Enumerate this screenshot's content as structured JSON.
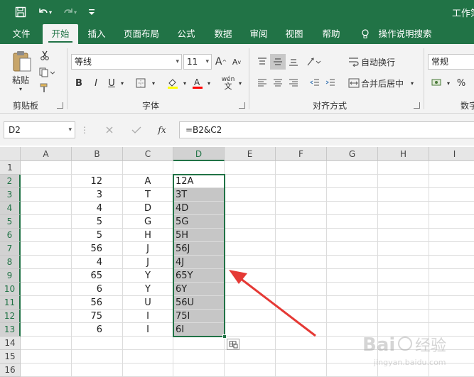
{
  "app": {
    "title": "工作簿"
  },
  "qat": {
    "save_icon": "save-icon",
    "undo_icon": "undo-icon",
    "redo_icon": "redo-icon",
    "customize_icon": "customize-icon"
  },
  "tabs": [
    "文件",
    "开始",
    "插入",
    "页面布局",
    "公式",
    "数据",
    "审阅",
    "视图",
    "帮助"
  ],
  "active_tab": "开始",
  "tell_me": "操作说明搜索",
  "ribbon": {
    "clipboard": {
      "paste_label": "粘贴",
      "group_label": "剪贴板"
    },
    "font": {
      "font_name": "等线",
      "font_size": "11",
      "bold": "B",
      "italic": "I",
      "underline": "U",
      "increase": "A",
      "decrease": "A",
      "group_label": "字体",
      "phonetic": "wén"
    },
    "alignment": {
      "wrap_text": "自动换行",
      "merge_center": "合并后居中",
      "group_label": "对齐方式"
    },
    "number": {
      "format": "常规",
      "percent": "%",
      "group_label": "数字"
    }
  },
  "formula_bar": {
    "name_box": "D2",
    "fx": "fx",
    "formula": "=B2&C2"
  },
  "grid": {
    "columns": [
      "A",
      "B",
      "C",
      "D",
      "E",
      "F",
      "G",
      "H",
      "I"
    ],
    "selected_column": "D",
    "rows": [
      {
        "n": "1",
        "b": "",
        "c": "",
        "d": ""
      },
      {
        "n": "2",
        "b": "12",
        "c": "A",
        "d": "12A"
      },
      {
        "n": "3",
        "b": "3",
        "c": "T",
        "d": "3T"
      },
      {
        "n": "4",
        "b": "4",
        "c": "D",
        "d": "4D"
      },
      {
        "n": "5",
        "b": "5",
        "c": "G",
        "d": "5G"
      },
      {
        "n": "6",
        "b": "5",
        "c": "H",
        "d": "5H"
      },
      {
        "n": "7",
        "b": "56",
        "c": "J",
        "d": "56J"
      },
      {
        "n": "8",
        "b": "4",
        "c": "J",
        "d": "4J"
      },
      {
        "n": "9",
        "b": "65",
        "c": "Y",
        "d": "65Y"
      },
      {
        "n": "10",
        "b": "6",
        "c": "Y",
        "d": "6Y"
      },
      {
        "n": "11",
        "b": "56",
        "c": "U",
        "d": "56U"
      },
      {
        "n": "12",
        "b": "75",
        "c": "I",
        "d": "75I"
      },
      {
        "n": "13",
        "b": "6",
        "c": "I",
        "d": "6I"
      },
      {
        "n": "14",
        "b": "",
        "c": "",
        "d": ""
      },
      {
        "n": "15",
        "b": "",
        "c": "",
        "d": ""
      },
      {
        "n": "16",
        "b": "",
        "c": "",
        "d": ""
      }
    ],
    "selected_rows": [
      "2",
      "3",
      "4",
      "5",
      "6",
      "7",
      "8",
      "9",
      "10",
      "11",
      "12",
      "13"
    ]
  },
  "colors": {
    "brand": "#217346",
    "arrow": "#e53935",
    "selection_fill": "#c6c6c6"
  },
  "annotation": {
    "arrow_icon": "red-arrow-icon"
  },
  "watermark": {
    "icon": "baidu-logo",
    "text": "Bai 经验",
    "url_text": "jingyan.baidu.com"
  }
}
